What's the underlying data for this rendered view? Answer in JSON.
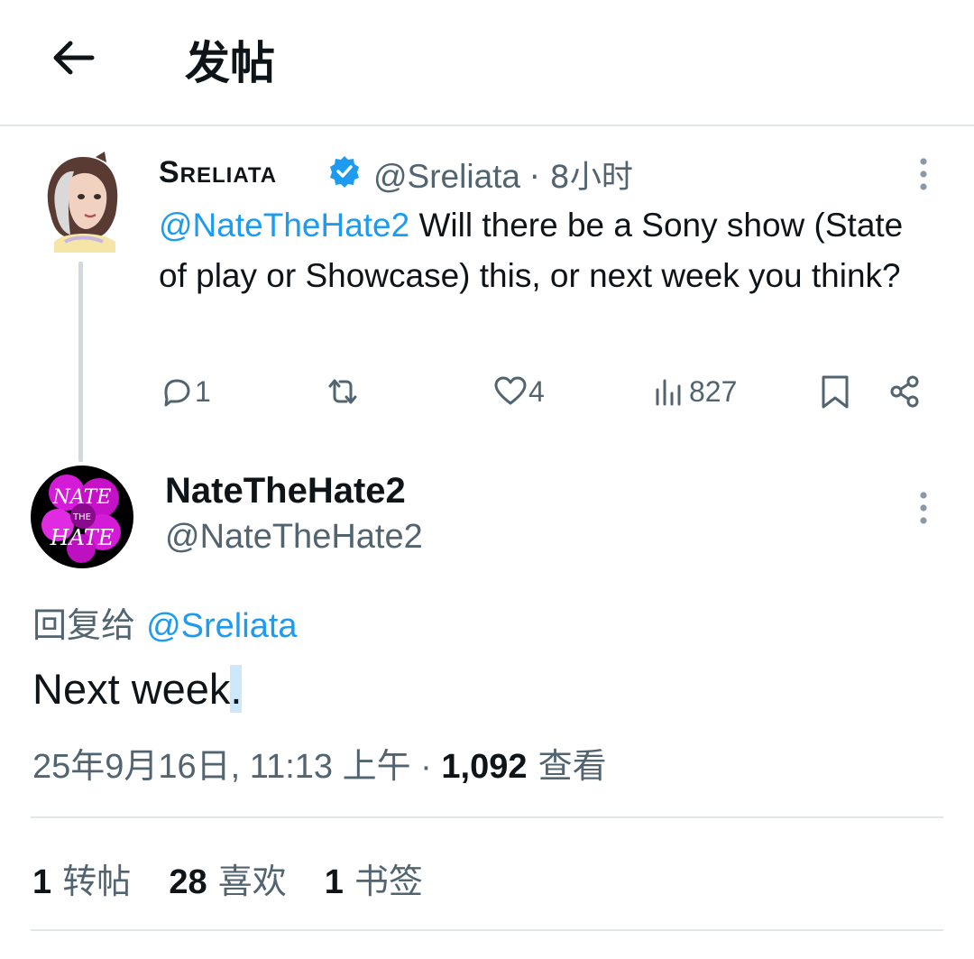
{
  "header": {
    "title": "发帖"
  },
  "parent_post": {
    "display_name": "Sreliata",
    "handle": "@Sreliata",
    "time": "· 8小时",
    "mention": "@NateTheHate2",
    "text": " Will there be a Sony show (State of play or Showcase) this, or next week you think?",
    "actions": {
      "replies": "1",
      "reposts": "",
      "likes": "4",
      "views": "827"
    }
  },
  "main_post": {
    "display_name": "NateTheHate2",
    "handle": "@NateTheHate2",
    "reply_prefix": "回复给 ",
    "reply_mention": "@Sreliata",
    "text": "Next week",
    "text_selected": ".",
    "date": "25年9月16日, 11:13 上午 · ",
    "views_count": "1,092",
    "views_label": " 查看"
  },
  "stats": {
    "reposts_count": "1",
    "reposts_label": " 转帖",
    "likes_count": "28",
    "likes_label": " 喜欢",
    "bookmarks_count": "1",
    "bookmarks_label": " 书签"
  },
  "colors": {
    "accent": "#1d9bf0",
    "muted": "#536471",
    "text": "#0f1419",
    "divider": "#e1e6ea"
  },
  "icons": [
    "back-arrow-icon",
    "verified-badge-icon",
    "more-vertical-icon",
    "reply-icon",
    "repost-icon",
    "like-icon",
    "views-icon",
    "bookmark-icon",
    "share-icon"
  ]
}
